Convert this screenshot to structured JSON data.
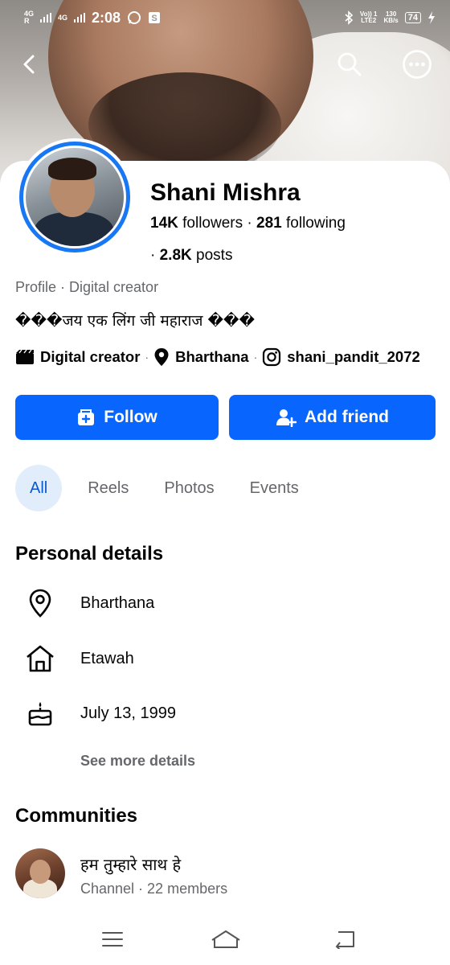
{
  "status_bar": {
    "sim1_label": "4G",
    "sim1_sub": "R",
    "sim2_label": "4G",
    "time": "2:08",
    "volte_top": "Vo)) 1",
    "volte_bottom": "LTE2",
    "speed_top": "130",
    "speed_bottom": "KB/s",
    "battery": "74"
  },
  "top_nav": {
    "back_icon": "back-arrow-icon",
    "search_icon": "search-icon",
    "more_icon": "more-options-icon"
  },
  "profile": {
    "name": "Shani Mishra",
    "followers_count": "14K",
    "followers_label": "followers",
    "following_count": "281",
    "following_label": "following",
    "posts_prefix": "·",
    "posts_count": "2.8K",
    "posts_label": "posts",
    "category_line": "Profile · Digital creator",
    "bio": "���जय एक लिंग जी महाराज ���",
    "info": {
      "category": "Digital creator",
      "location": "Bharthana",
      "instagram": "shani_pandit_2072"
    }
  },
  "actions": {
    "follow_label": "Follow",
    "add_friend_label": "Add friend"
  },
  "tabs": [
    {
      "label": "All",
      "active": true
    },
    {
      "label": "Reels",
      "active": false
    },
    {
      "label": "Photos",
      "active": false
    },
    {
      "label": "Events",
      "active": false
    }
  ],
  "personal_details": {
    "title": "Personal details",
    "items": [
      {
        "icon": "location-pin-icon",
        "text": "Bharthana"
      },
      {
        "icon": "home-icon",
        "text": "Etawah"
      },
      {
        "icon": "birthday-cake-icon",
        "text": "July 13, 1999"
      }
    ],
    "see_more": "See more details"
  },
  "communities": {
    "title": "Communities",
    "items": [
      {
        "name": "हम तुम्हारे साथ हे",
        "meta": "Channel · 22 members"
      }
    ]
  },
  "colors": {
    "accent": "#0866ff",
    "avatar_ring": "#1877f2",
    "active_tab_bg": "#e2edfb",
    "active_tab_text": "#0a58ca",
    "secondary_text": "#65676b"
  }
}
